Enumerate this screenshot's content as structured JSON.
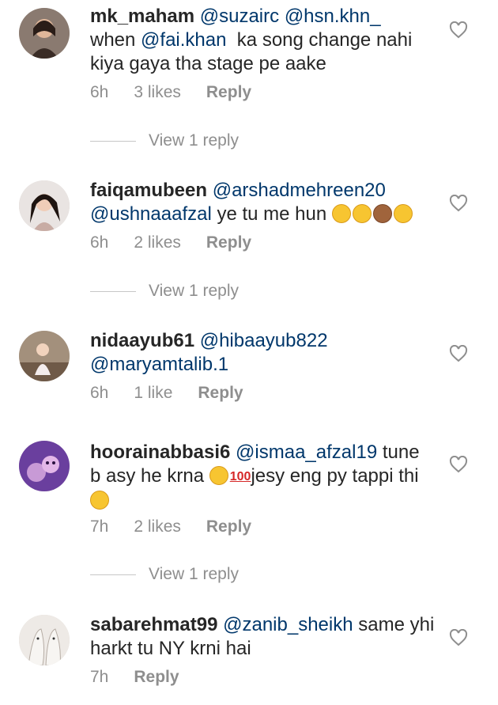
{
  "comments": [
    {
      "username": "mk_maham",
      "mentions": [
        "@suzairc",
        "@hsn.khn_"
      ],
      "line2_prefix": "when ",
      "line2_mention": "@fai.khan",
      "line2_suffix": "  ka song change nahi",
      "line3": "kiya gaya tha stage pe aake",
      "time": "6h",
      "likes": "3 likes",
      "reply": "Reply",
      "view_reply": "View 1 reply"
    },
    {
      "username": "faiqamubeen",
      "mention1": "@arshadmehreen20",
      "mention2": "@ushnaaafzal",
      "body": " ye tu me hun ",
      "emojis": [
        "pleading-face",
        "tears-of-joy",
        "see-no-evil-monkey",
        "tears-of-joy"
      ],
      "time": "6h",
      "likes": "2 likes",
      "reply": "Reply",
      "view_reply": "View 1 reply"
    },
    {
      "username": "nidaayub61",
      "mention1": "@hibaayub822",
      "mention2": "@maryamtalib.1",
      "time": "6h",
      "likes": "1 like",
      "reply": "Reply"
    },
    {
      "username": "hoorainabbasi6",
      "mention1": "@ismaa_afzal19",
      "body1": " tune",
      "body2a": "b asy he krna ",
      "emoji100": "100",
      "body2b": "jesy eng py tappi thi",
      "emojis": [
        "tears-of-joy",
        "grimacing-face"
      ],
      "time": "7h",
      "likes": "2 likes",
      "reply": "Reply",
      "view_reply": "View 1 reply"
    },
    {
      "username": "sabarehmat99",
      "mention1": "@zanib_sheikh",
      "body1": " same yhi",
      "body2": "harkt tu NY krni hai",
      "time": "7h",
      "reply": "Reply"
    }
  ],
  "icons": {
    "like": "heart-outline-icon"
  },
  "colors": {
    "mention": "#00376b",
    "meta": "#8e8e8e",
    "text": "#262626"
  }
}
